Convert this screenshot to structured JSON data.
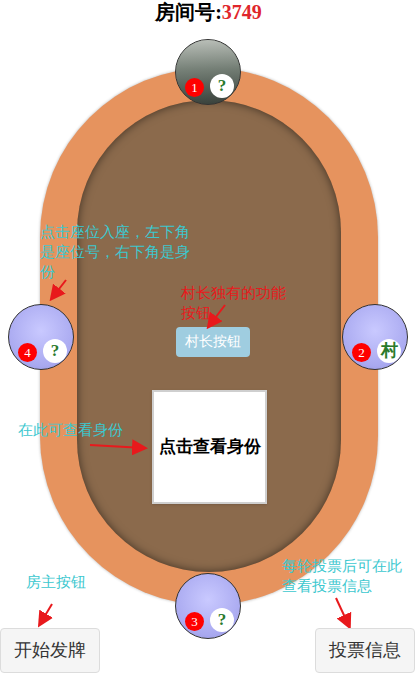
{
  "room": {
    "label": "房间号:",
    "number": "3749"
  },
  "seats": [
    {
      "number": "1",
      "identity": "?",
      "kind": "photo"
    },
    {
      "number": "2",
      "identity": "村",
      "kind": "empty"
    },
    {
      "number": "3",
      "identity": "?",
      "kind": "empty"
    },
    {
      "number": "4",
      "identity": "?",
      "kind": "empty"
    }
  ],
  "chief_button": "村长按钮",
  "identity_card": "点击查看身份",
  "buttons": {
    "deal": "开始发牌",
    "votes": "投票信息"
  },
  "annotations": [
    {
      "text": "点击座位入座，左下角是座位号，右下角是身份",
      "color": "#3cc8cf"
    },
    {
      "text": "村长独有的功能按钮",
      "color": "#e8191c"
    },
    {
      "text": "在此可查看身份",
      "color": "#3cc8cf"
    },
    {
      "text": "房主按钮",
      "color": "#3cc8cf"
    },
    {
      "text": "每轮投票后可在此查看投票信息",
      "color": "#3cc8cf"
    }
  ]
}
